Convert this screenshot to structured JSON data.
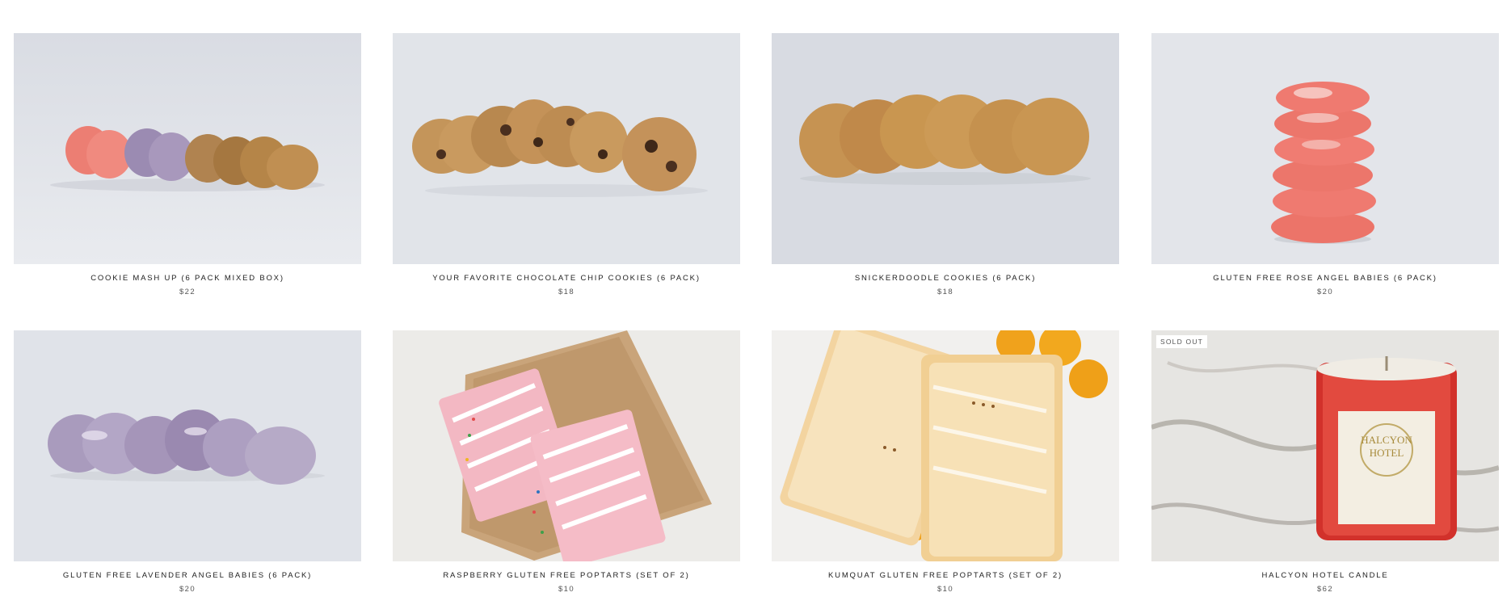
{
  "products": [
    {
      "title": "COOKIE MASH UP (6 PACK MIXED BOX)",
      "price": "$22",
      "image": "mixed-cookies-row"
    },
    {
      "title": "YOUR FAVORITE CHOCOLATE CHIP COOKIES (6 PACK)",
      "price": "$18",
      "image": "chocolate-chip-cookies-row"
    },
    {
      "title": "SNICKERDOODLE COOKIES (6 PACK)",
      "price": "$18",
      "image": "snickerdoodle-cookies-row"
    },
    {
      "title": "GLUTEN FREE ROSE ANGEL BABIES (6 PACK)",
      "price": "$20",
      "image": "rose-cookie-stack"
    },
    {
      "title": "GLUTEN FREE LAVENDER ANGEL BABIES (6 PACK)",
      "price": "$20",
      "image": "lavender-cookies-row"
    },
    {
      "title": "RASPBERRY GLUTEN FREE POPTARTS (SET OF 2)",
      "price": "$10",
      "image": "raspberry-poptarts"
    },
    {
      "title": "KUMQUAT GLUTEN FREE POPTARTS (SET OF 2)",
      "price": "$10",
      "image": "kumquat-poptarts"
    },
    {
      "title": "HALCYON HOTEL CANDLE",
      "price": "$62",
      "image": "red-candle",
      "badge": "SOLD OUT",
      "candle_label": [
        "HALCYON",
        "HOTEL"
      ]
    }
  ],
  "colors": {
    "background": "#ffffff",
    "title_text": "#222222",
    "price_text": "#555555",
    "photo_backdrop": "#dfe2e8"
  }
}
